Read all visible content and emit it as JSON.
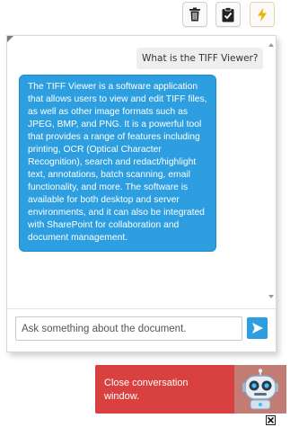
{
  "toolbar": {
    "delete_icon": "trash-icon",
    "clipboard_icon": "clipboard-check-icon",
    "flash_icon": "lightning-icon",
    "flash_color": "#f0b400"
  },
  "chat": {
    "user_message": "What is the TIFF Viewer?",
    "bot_message": "The TIFF Viewer is a software application that allows users to view and edit TIFF files, as well as other image formats such as JPEG, BMP, and PNG. It is a powerful tool that provides a range of features including printing, OCR (Optical Character Recognition), search and redact/highlight text, annotations, batch scanning, email functionality, and more. The software is available for both desktop and server environments, and it can also be integrated with SharePoint for collaboration and document management.",
    "bot_bubble_color": "#2d9fe0"
  },
  "input": {
    "placeholder": "Ask something about the document.",
    "value": "",
    "send_icon": "send-arrow-icon"
  },
  "close_banner": {
    "text": "Close conversation window.",
    "color": "#d94040",
    "avatar_icon": "robot-icon"
  },
  "dismiss": {
    "icon": "close-icon"
  }
}
